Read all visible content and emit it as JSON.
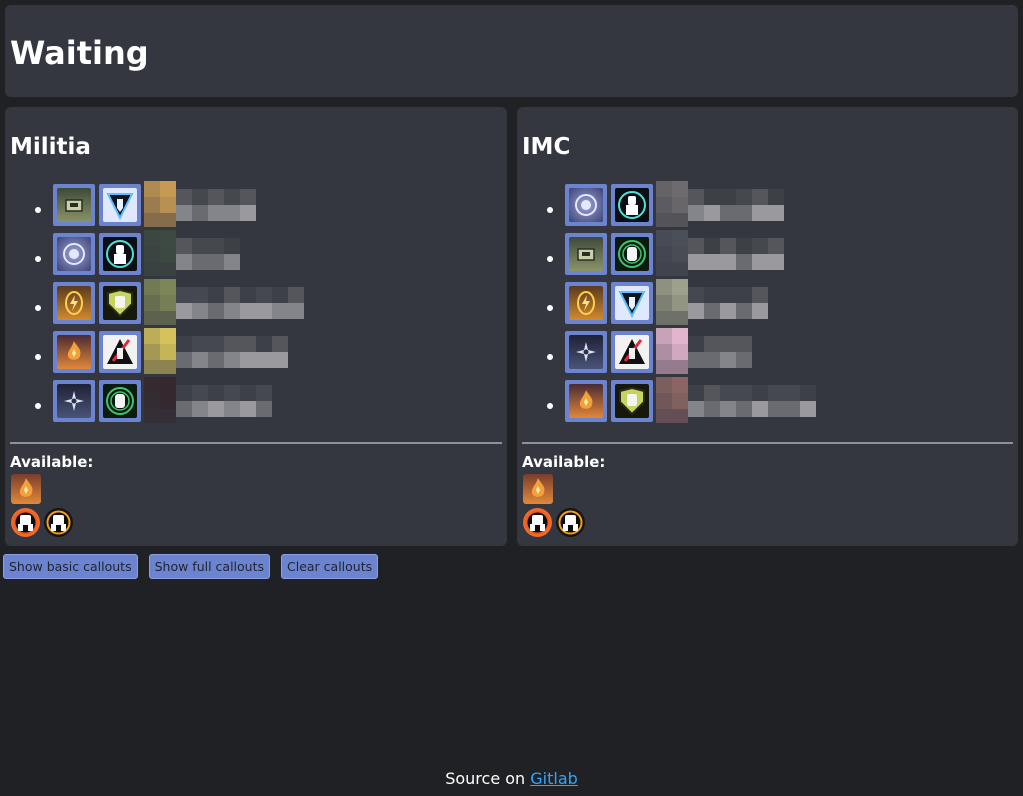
{
  "status": {
    "title": "Waiting"
  },
  "teams": [
    {
      "name": "Militia",
      "players": [
        {
          "kit_icon": "ammo-crate-icon",
          "titan_icon": "northstar-titan-icon",
          "name_color": "#c69a55"
        },
        {
          "kit_icon": "shield-drone-icon",
          "titan_icon": "ion-titan-icon",
          "name_color": "#3d4a42"
        },
        {
          "kit_icon": "electric-smoke-icon",
          "titan_icon": "legion-titan-icon",
          "name_color": "#7c8658"
        },
        {
          "kit_icon": "firestar-icon",
          "titan_icon": "ronin-titan-icon",
          "name_color": "#d6c25c"
        },
        {
          "kit_icon": "shuriken-icon",
          "titan_icon": "monarch-titan-icon",
          "name_color": "#35282e"
        }
      ],
      "available": {
        "label": "Available:",
        "kits": [
          "firestar-icon"
        ],
        "titans": [
          "scorch-titan-icon",
          "tone-titan-icon"
        ]
      }
    },
    {
      "name": "IMC",
      "players": [
        {
          "kit_icon": "shield-drone-icon",
          "titan_icon": "ion-titan-icon",
          "name_color": "#6e6b6f"
        },
        {
          "kit_icon": "ammo-crate-icon",
          "titan_icon": "monarch-titan-icon",
          "name_color": "#4b4f58"
        },
        {
          "kit_icon": "electric-smoke-icon",
          "titan_icon": "northstar-titan-icon",
          "name_color": "#9da08c"
        },
        {
          "kit_icon": "shuriken-icon",
          "titan_icon": "ronin-titan-icon",
          "name_color": "#e2b5cc"
        },
        {
          "kit_icon": "firestar-icon",
          "titan_icon": "legion-titan-icon",
          "name_color": "#8a6564"
        }
      ],
      "available": {
        "label": "Available:",
        "kits": [
          "firestar-icon"
        ],
        "titans": [
          "scorch-titan-icon",
          "tone-titan-icon"
        ]
      }
    }
  ],
  "buttons": {
    "basic": "Show basic callouts",
    "full": "Show full callouts",
    "clear": "Clear callouts"
  },
  "footer": {
    "prefix": "Source on",
    "link": "Gitlab"
  },
  "colors": {
    "panel": "#353740",
    "background": "#202124",
    "accent": "#6c84cf",
    "link": "#2ea6ff"
  }
}
